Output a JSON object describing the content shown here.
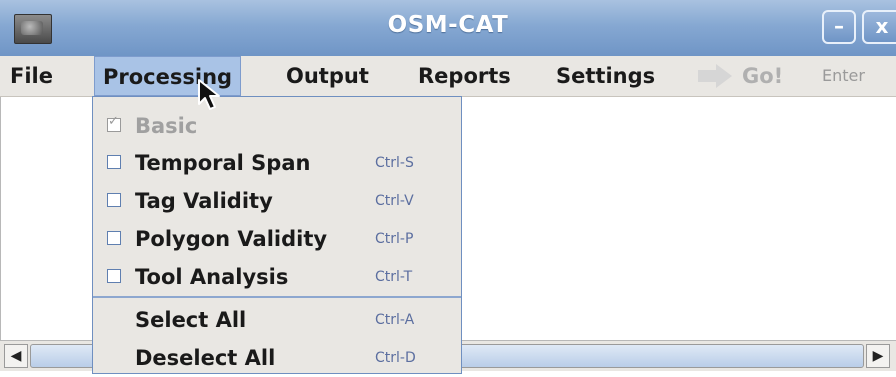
{
  "window": {
    "title": "OSM-CAT",
    "minimize_label": "–",
    "close_label": "x"
  },
  "menubar": {
    "items": [
      "File",
      "Processing",
      "Output",
      "Reports",
      "Settings"
    ],
    "go_label": "Go!",
    "enter_label": "Enter"
  },
  "dropdown": {
    "items": [
      {
        "label": "Basic",
        "shortcut": "",
        "checked": true,
        "disabled": true
      },
      {
        "label": "Temporal Span",
        "shortcut": "Ctrl-S",
        "checked": false,
        "disabled": false
      },
      {
        "label": "Tag Validity",
        "shortcut": "Ctrl-V",
        "checked": false,
        "disabled": false
      },
      {
        "label": "Polygon Validity",
        "shortcut": "Ctrl-P",
        "checked": false,
        "disabled": false
      },
      {
        "label": "Tool Analysis",
        "shortcut": "Ctrl-T",
        "checked": false,
        "disabled": false
      },
      {
        "label": "Select All",
        "shortcut": "Ctrl-A"
      },
      {
        "label": "Deselect All",
        "shortcut": "Ctrl-D"
      }
    ]
  },
  "scrollbar": {
    "left_arrow": "◀",
    "right_arrow": "▶"
  },
  "colors": {
    "accent": "#a9c3e6",
    "titlebar": "#86a8d2"
  }
}
